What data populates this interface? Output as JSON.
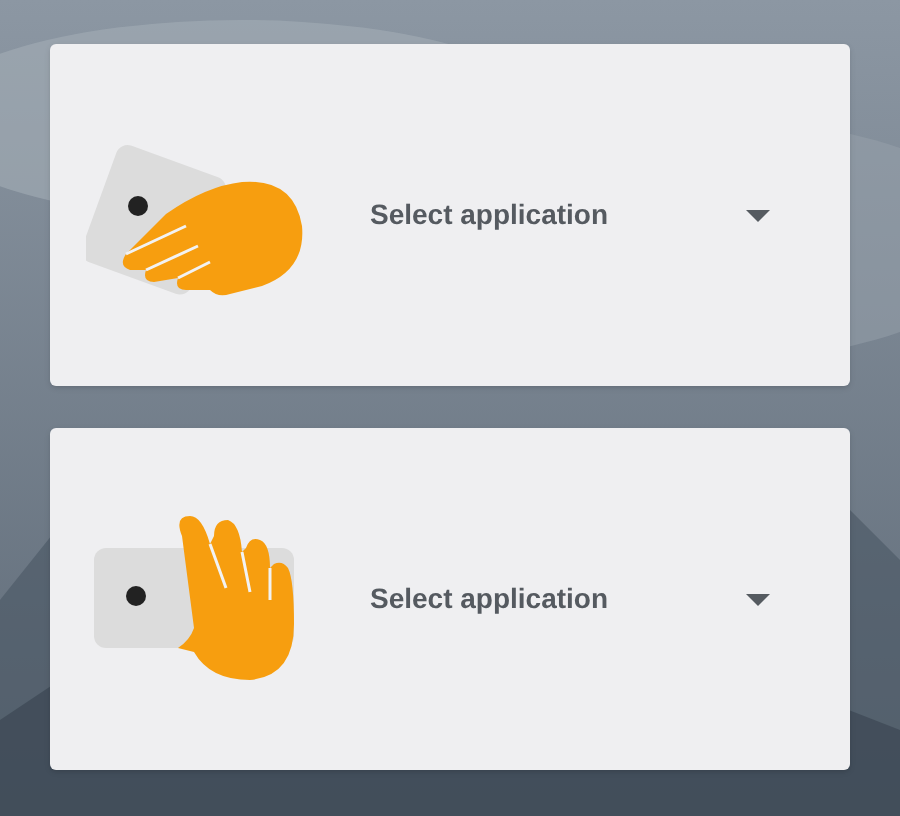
{
  "gesture_cards": [
    {
      "kind": "swipe",
      "dropdown": {
        "value": "Select application"
      }
    },
    {
      "kind": "wave",
      "dropdown": {
        "value": "Select application"
      }
    }
  ]
}
